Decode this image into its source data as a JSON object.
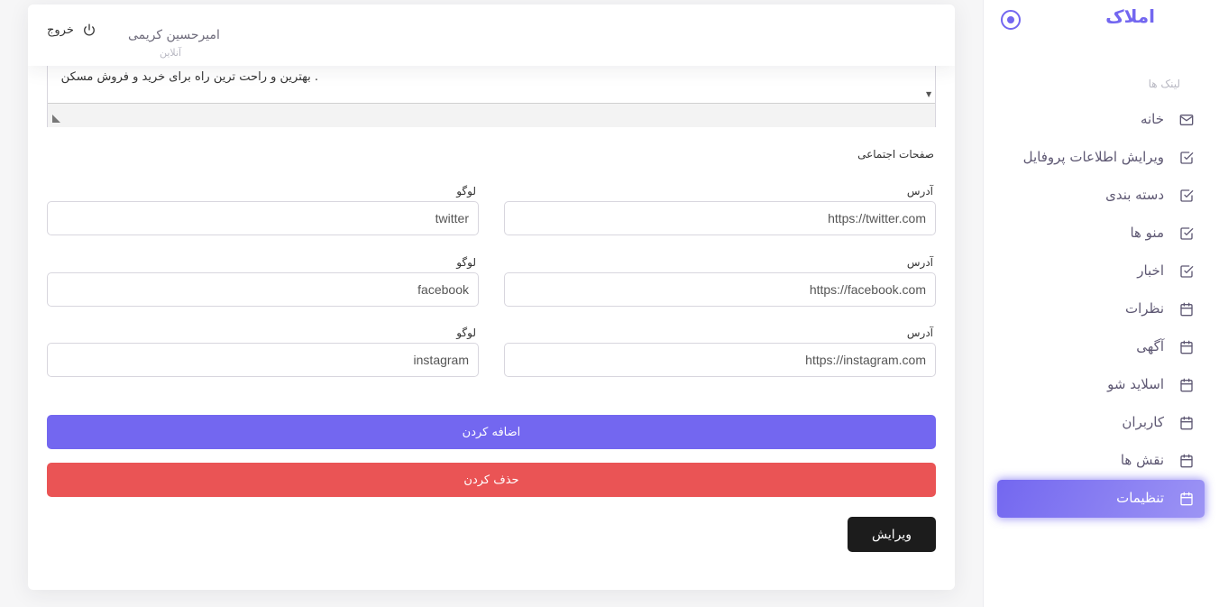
{
  "sidebar": {
    "brand": "املاک",
    "section_label": "لینک ها",
    "items": [
      {
        "label": "خانه",
        "icon": "mail-icon"
      },
      {
        "label": "ویرایش اطلاعات پروفایل",
        "icon": "check-square-icon"
      },
      {
        "label": "دسته بندی",
        "icon": "check-square-icon"
      },
      {
        "label": "منو ها",
        "icon": "check-square-icon"
      },
      {
        "label": "اخبار",
        "icon": "check-square-icon"
      },
      {
        "label": "نظرات",
        "icon": "calendar-icon"
      },
      {
        "label": "آگهی",
        "icon": "calendar-icon"
      },
      {
        "label": "اسلاید شو",
        "icon": "calendar-icon"
      },
      {
        "label": "کاربران",
        "icon": "calendar-icon"
      },
      {
        "label": "نقش ها",
        "icon": "calendar-icon"
      },
      {
        "label": "تنظیمات",
        "icon": "calendar-icon",
        "active": true
      }
    ]
  },
  "topbar": {
    "user_name": "امیرحسین کریمی",
    "user_status": "آنلاین",
    "logout_label": "خروج"
  },
  "description": {
    "text": "بهترین و راحت ترین راه برای خرید و فروش مسکن ."
  },
  "social": {
    "title": "صفحات اجتماعی",
    "address_label": "آدرس",
    "logo_label": "لوگو",
    "rows": [
      {
        "address": "https://twitter.com",
        "logo": "twitter"
      },
      {
        "address": "https://facebook.com",
        "logo": "facebook"
      },
      {
        "address": "https://instagram.com",
        "logo": "instagram"
      }
    ]
  },
  "buttons": {
    "add": "اضافه کردن",
    "delete": "حذف کردن",
    "edit": "ویرایش"
  },
  "colors": {
    "primary": "#7367f0",
    "danger": "#ea5455",
    "dark": "#1c1c1c"
  }
}
